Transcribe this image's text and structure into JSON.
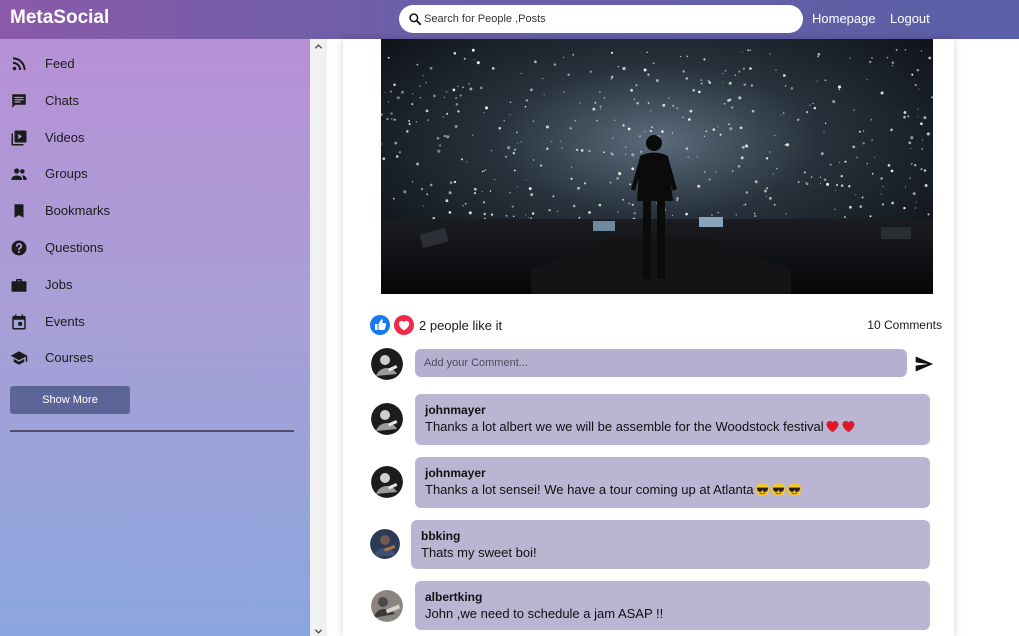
{
  "header": {
    "brand": "MetaSocial",
    "search_placeholder": "Search for People ,Posts",
    "nav": {
      "homepage": "Homepage",
      "logout": "Logout"
    }
  },
  "sidebar": {
    "items": [
      {
        "label": "Feed",
        "icon": "rss-feed-icon"
      },
      {
        "label": "Chats",
        "icon": "chat-icon"
      },
      {
        "label": "Videos",
        "icon": "video-library-icon"
      },
      {
        "label": "Groups",
        "icon": "group-icon"
      },
      {
        "label": "Bookmarks",
        "icon": "bookmark-icon"
      },
      {
        "label": "Questions",
        "icon": "help-circle-icon"
      },
      {
        "label": "Jobs",
        "icon": "briefcase-icon"
      },
      {
        "label": "Events",
        "icon": "calendar-icon"
      },
      {
        "label": "Courses",
        "icon": "school-icon"
      }
    ],
    "show_more": "Show More"
  },
  "post": {
    "likes_text": "2 people like it",
    "comments_count": "10 Comments",
    "comment_placeholder": "Add your Comment...",
    "comments": [
      {
        "user": "johnmayer",
        "text": "Thanks a lot albert we we will be assemble for the Woodstock festival",
        "emojis": [
          "heart",
          "heart"
        ]
      },
      {
        "user": "johnmayer",
        "text": "Thanks a lot sensei! We have a tour coming up at Atlanta",
        "emojis": [
          "sunglasses",
          "sunglasses",
          "sunglasses"
        ]
      },
      {
        "user": "bbking",
        "text": "Thats my sweet boi!",
        "emojis": []
      },
      {
        "user": "albertking",
        "text": "John ,we need to schedule a jam ASAP !!",
        "emojis": []
      }
    ]
  },
  "colors": {
    "topbar": "#7a5ca8",
    "sidebar_top": "#b790d6",
    "sidebar_bottom": "#8aa6de",
    "bubble": "#b9b5d2",
    "button": "#5d6498",
    "like_blue": "#1877f2",
    "love_red": "#f0284a"
  }
}
